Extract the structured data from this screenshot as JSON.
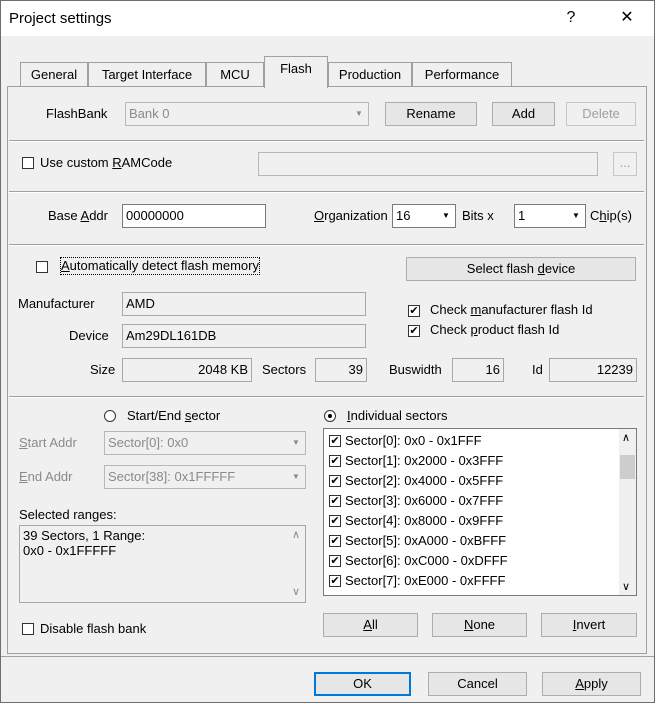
{
  "window": {
    "title": "Project settings",
    "help_glyph": "?",
    "close_glyph": "✕"
  },
  "tabs": [
    {
      "label": "General"
    },
    {
      "label": "Target Interface"
    },
    {
      "label": "MCU"
    },
    {
      "label": "Flash"
    },
    {
      "label": "Production"
    },
    {
      "label": "Performance"
    }
  ],
  "active_tab": "Flash",
  "flashbank": {
    "label": "FlashBank",
    "value": "Bank 0",
    "rename": "Rename",
    "add": "Add",
    "delete": "Delete"
  },
  "ramcode": {
    "label_pre": "Use custom ",
    "label_u": "R",
    "label_post": "AMCode",
    "value": "",
    "browse": "...",
    "checked": false
  },
  "base": {
    "label_pre": "Base ",
    "label_u": "A",
    "label_post": "ddr",
    "value": "00000000"
  },
  "organization": {
    "label_u": "O",
    "label_post": "rganization",
    "bits_value": "16",
    "bits_label": "Bits x",
    "chips_value": "1",
    "chips_label_pre": "C",
    "chips_label_u": "h",
    "chips_label_post": "ip(s)"
  },
  "autodetect": {
    "label_u": "A",
    "label_post": "utomatically detect flash memory",
    "checked": false
  },
  "select_device": {
    "label_pre": "Select flash ",
    "label_u": "d",
    "label_post": "evice"
  },
  "manufacturer": {
    "label": "Manufacturer",
    "value": "AMD"
  },
  "device": {
    "label": "Device",
    "value": "Am29DL161DB"
  },
  "check_mfr": {
    "label_pre": "Check ",
    "label_u": "m",
    "label_post": "anufacturer flash Id",
    "checked": true
  },
  "check_prod": {
    "label_pre": "Check ",
    "label_u": "p",
    "label_post": "roduct flash Id",
    "checked": true
  },
  "info": {
    "size_label": "Size",
    "size_value": "2048 KB",
    "sectors_label": "Sectors",
    "sectors_value": "39",
    "buswidth_label": "Buswidth",
    "buswidth_value": "16",
    "id_label": "Id",
    "id_value": "12239"
  },
  "startend": {
    "label_pre": "Start/End ",
    "label_u": "s",
    "label_post": "ector",
    "selected": false
  },
  "individual": {
    "label_u": "I",
    "label_post": "ndividual sectors",
    "selected": true
  },
  "start_addr": {
    "label_u": "S",
    "label_post": "tart Addr",
    "value": "Sector[0]: 0x0"
  },
  "end_addr": {
    "label_u": "E",
    "label_post": "nd Addr",
    "value": "Sector[38]: 0x1FFFFF"
  },
  "selected_ranges": {
    "label": "Selected ranges:",
    "line1": "39 Sectors, 1 Range:",
    "line2": "0x0 - 0x1FFFFF"
  },
  "sectors": [
    {
      "label": "Sector[0]: 0x0 - 0x1FFF",
      "checked": true
    },
    {
      "label": "Sector[1]: 0x2000 - 0x3FFF",
      "checked": true
    },
    {
      "label": "Sector[2]: 0x4000 - 0x5FFF",
      "checked": true
    },
    {
      "label": "Sector[3]: 0x6000 - 0x7FFF",
      "checked": true
    },
    {
      "label": "Sector[4]: 0x8000 - 0x9FFF",
      "checked": true
    },
    {
      "label": "Sector[5]: 0xA000 - 0xBFFF",
      "checked": true
    },
    {
      "label": "Sector[6]: 0xC000 - 0xDFFF",
      "checked": true
    },
    {
      "label": "Sector[7]: 0xE000 - 0xFFFF",
      "checked": true
    }
  ],
  "disable_bank": {
    "label": "Disable flash bank",
    "checked": false
  },
  "sector_buttons": {
    "all": "All",
    "none": "None",
    "invert": "Invert"
  },
  "dialog_buttons": {
    "ok": "OK",
    "cancel": "Cancel",
    "apply": "Apply"
  },
  "icons": {
    "check": "✔",
    "dd": "▼",
    "up": "∧",
    "down": "∨"
  }
}
